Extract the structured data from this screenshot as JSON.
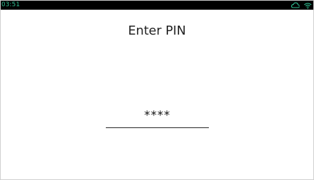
{
  "status_bar": {
    "time": "03:51",
    "icons": [
      "cloud-icon",
      "wifi-icon"
    ],
    "accent_color": "#2fbf92"
  },
  "screen": {
    "title": "Enter PIN",
    "pin_value": "****"
  }
}
